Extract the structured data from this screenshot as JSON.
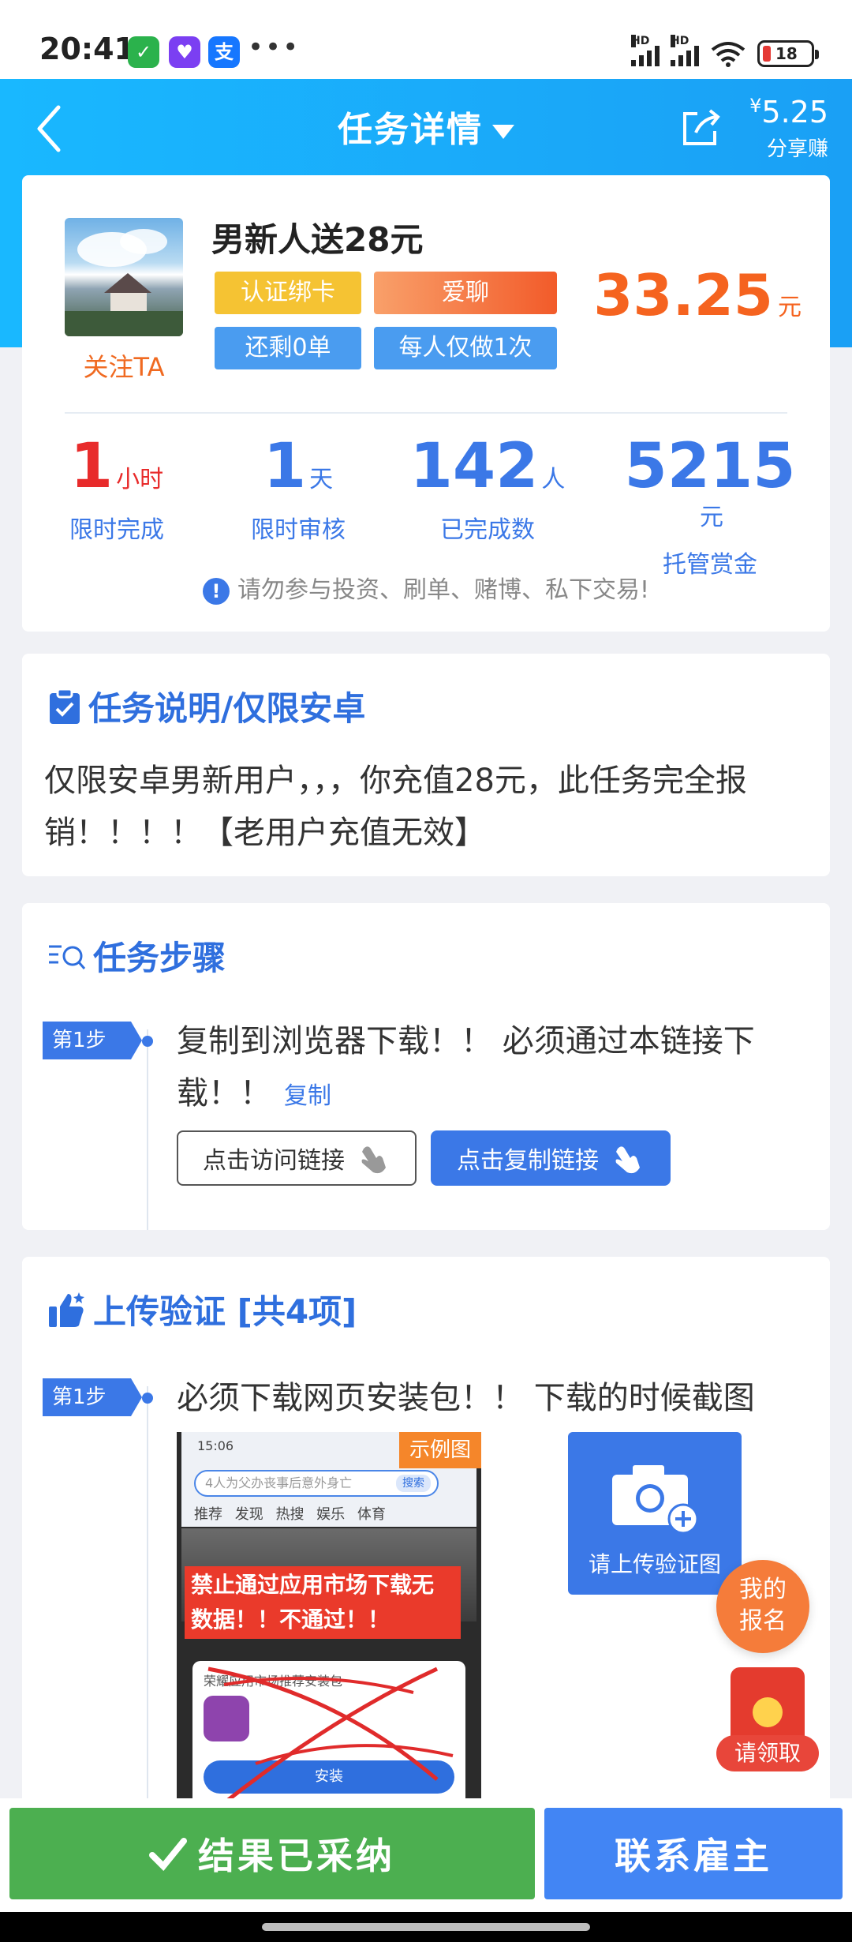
{
  "status_bar": {
    "time": "20:41",
    "apps": [
      {
        "name": "wechat-icon",
        "glyph": "✓",
        "color": "#2bb24c"
      },
      {
        "name": "cat-app-icon",
        "glyph": "♥",
        "color": "#7b3ff2"
      },
      {
        "name": "alipay-icon",
        "glyph": "支",
        "color": "#1677ff"
      }
    ],
    "more": "•••",
    "network_label": "HD",
    "battery": "18"
  },
  "header": {
    "title": "任务详情",
    "share_amount": "5.25",
    "share_currency": "¥",
    "share_label": "分享赚"
  },
  "task": {
    "name": "男新人送28元",
    "follow_label": "关注TA",
    "tags": [
      "认证绑卡",
      "爱聊",
      "还剩0单",
      "每人仅做1次"
    ],
    "price": "33.25",
    "price_unit": "元",
    "stats": [
      {
        "value": "1",
        "unit": "小时",
        "label": "限时完成",
        "color": "#e82b2b"
      },
      {
        "value": "1",
        "unit": "天",
        "label": "限时审核",
        "color": "#3b78e7"
      },
      {
        "value": "142",
        "unit": "人",
        "label": "已完成数",
        "color": "#3b78e7"
      },
      {
        "value": "5215",
        "unit": "元",
        "label": "托管赏金",
        "color": "#3b78e7"
      }
    ],
    "warning": "请勿参与投资、刷单、赌博、私下交易!"
  },
  "description": {
    "title": "任务说明/仅限安卓",
    "text": "仅限安卓男新用户，，，你充值28元，此任务完全报销！！！！【老用户充值无效】"
  },
  "steps": {
    "title": "任务步骤",
    "step_label": "第1步",
    "text": "复制到浏览器下载！！ 必须通过本链接下载！！",
    "copy_label": "复制",
    "visit_button": "点击访问链接",
    "copy_button": "点击复制链接"
  },
  "upload": {
    "title": "上传验证 [共4项]",
    "step_label": "第1步",
    "text": "必须下载网页安装包！！ 下载的时候截图",
    "example_badge": "示例图",
    "example_screen": {
      "time": "15:06",
      "search_placeholder": "4人为父办丧事后意外身亡",
      "search_button": "搜索",
      "tabs": "推荐 发现 热搜 娱乐 体育",
      "red_text": "禁止通过应用市场下载无数据！！不通过！！",
      "dialog_title": "荣耀应用市场推荐安装包",
      "install_label": "安装"
    },
    "upload_label": "请上传验证图"
  },
  "floating": {
    "signup_line1": "我的",
    "signup_line2": "报名",
    "redpacket_label": "请领取"
  },
  "bottom": {
    "adopted_label": "结果已采纳",
    "contact_label": "联系雇主"
  }
}
